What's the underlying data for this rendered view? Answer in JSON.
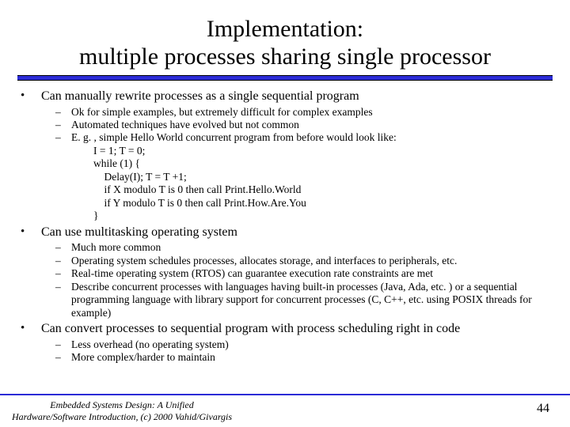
{
  "title_line1": "Implementation:",
  "title_line2": "multiple processes sharing single processor",
  "p1": {
    "text": "Can manually rewrite processes as a single sequential program",
    "sub": [
      "Ok for simple examples, but extremely difficult for complex examples",
      "Automated techniques have evolved but not common",
      "E. g. , simple Hello World concurrent program from before would look like:"
    ],
    "code": [
      "I = 1; T = 0;",
      "while (1) {",
      "    Delay(I); T = T +1;",
      "    if X modulo T is 0 then call Print.Hello.World",
      "    if Y modulo T is 0 then call Print.How.Are.You",
      "}"
    ]
  },
  "p2": {
    "text": "Can use multitasking operating system",
    "sub": [
      "Much more common",
      "Operating system schedules processes, allocates storage, and interfaces to peripherals, etc.",
      "Real-time operating system (RTOS) can guarantee execution rate constraints are met",
      "Describe concurrent processes with languages having built-in processes (Java, Ada, etc. ) or a sequential programming language with library support for concurrent processes (C, C++, etc. using POSIX threads for example)"
    ]
  },
  "p3": {
    "text": "Can convert processes to sequential program with process scheduling right in code",
    "sub": [
      "Less overhead (no operating system)",
      "More complex/harder to maintain"
    ]
  },
  "footer_left_l1": "Embedded Systems Design: A Unified",
  "footer_left_l2": "Hardware/Software Introduction, (c) 2000 Vahid/Givargis",
  "page_number": "44",
  "dash": "–",
  "dot": "•"
}
